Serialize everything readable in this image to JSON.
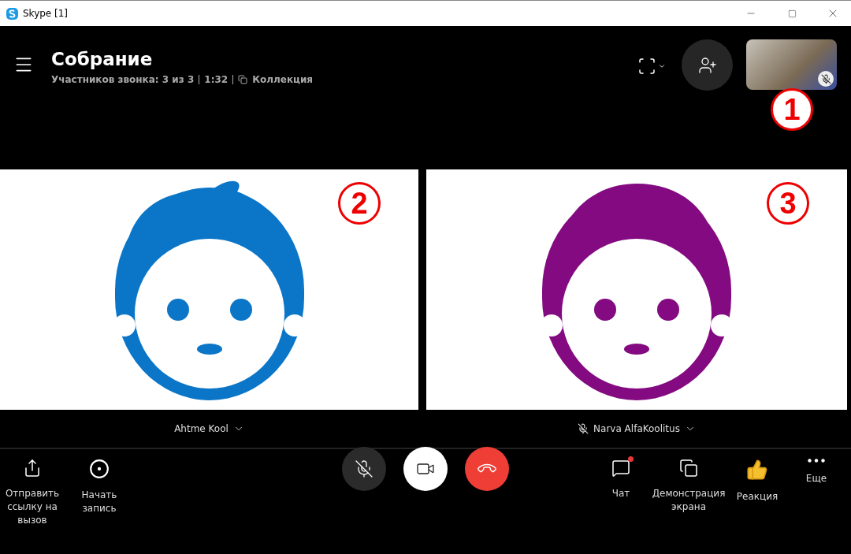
{
  "window": {
    "title": "Skype [1]"
  },
  "call": {
    "title": "Собрание",
    "participants": "Участников звонка: 3 из 3",
    "duration": "1:32",
    "gallery": "Коллекция"
  },
  "self_view": {
    "muted": true,
    "annotation": "1"
  },
  "participants": [
    {
      "name": "Ahtme Kool",
      "color": "#0b76c8",
      "muted": false,
      "annotation": "2",
      "kind": "boy"
    },
    {
      "name": "Narva AlfaKoolitus",
      "color": "#830a80",
      "muted": true,
      "annotation": "3",
      "kind": "girl"
    }
  ],
  "left_actions": [
    {
      "label": "Отправить ссылку на вызов",
      "kind": "share"
    },
    {
      "label": "Начать запись",
      "kind": "record"
    }
  ],
  "call_controls": {
    "mic_muted": true
  },
  "right_actions": [
    {
      "label": "Чат",
      "kind": "chat",
      "badge": true
    },
    {
      "label": "Демонстрация экрана",
      "kind": "screen",
      "badge": false
    },
    {
      "label": "Реакция",
      "kind": "reaction",
      "badge": false
    },
    {
      "label": "Еще",
      "kind": "more",
      "badge": false
    }
  ]
}
